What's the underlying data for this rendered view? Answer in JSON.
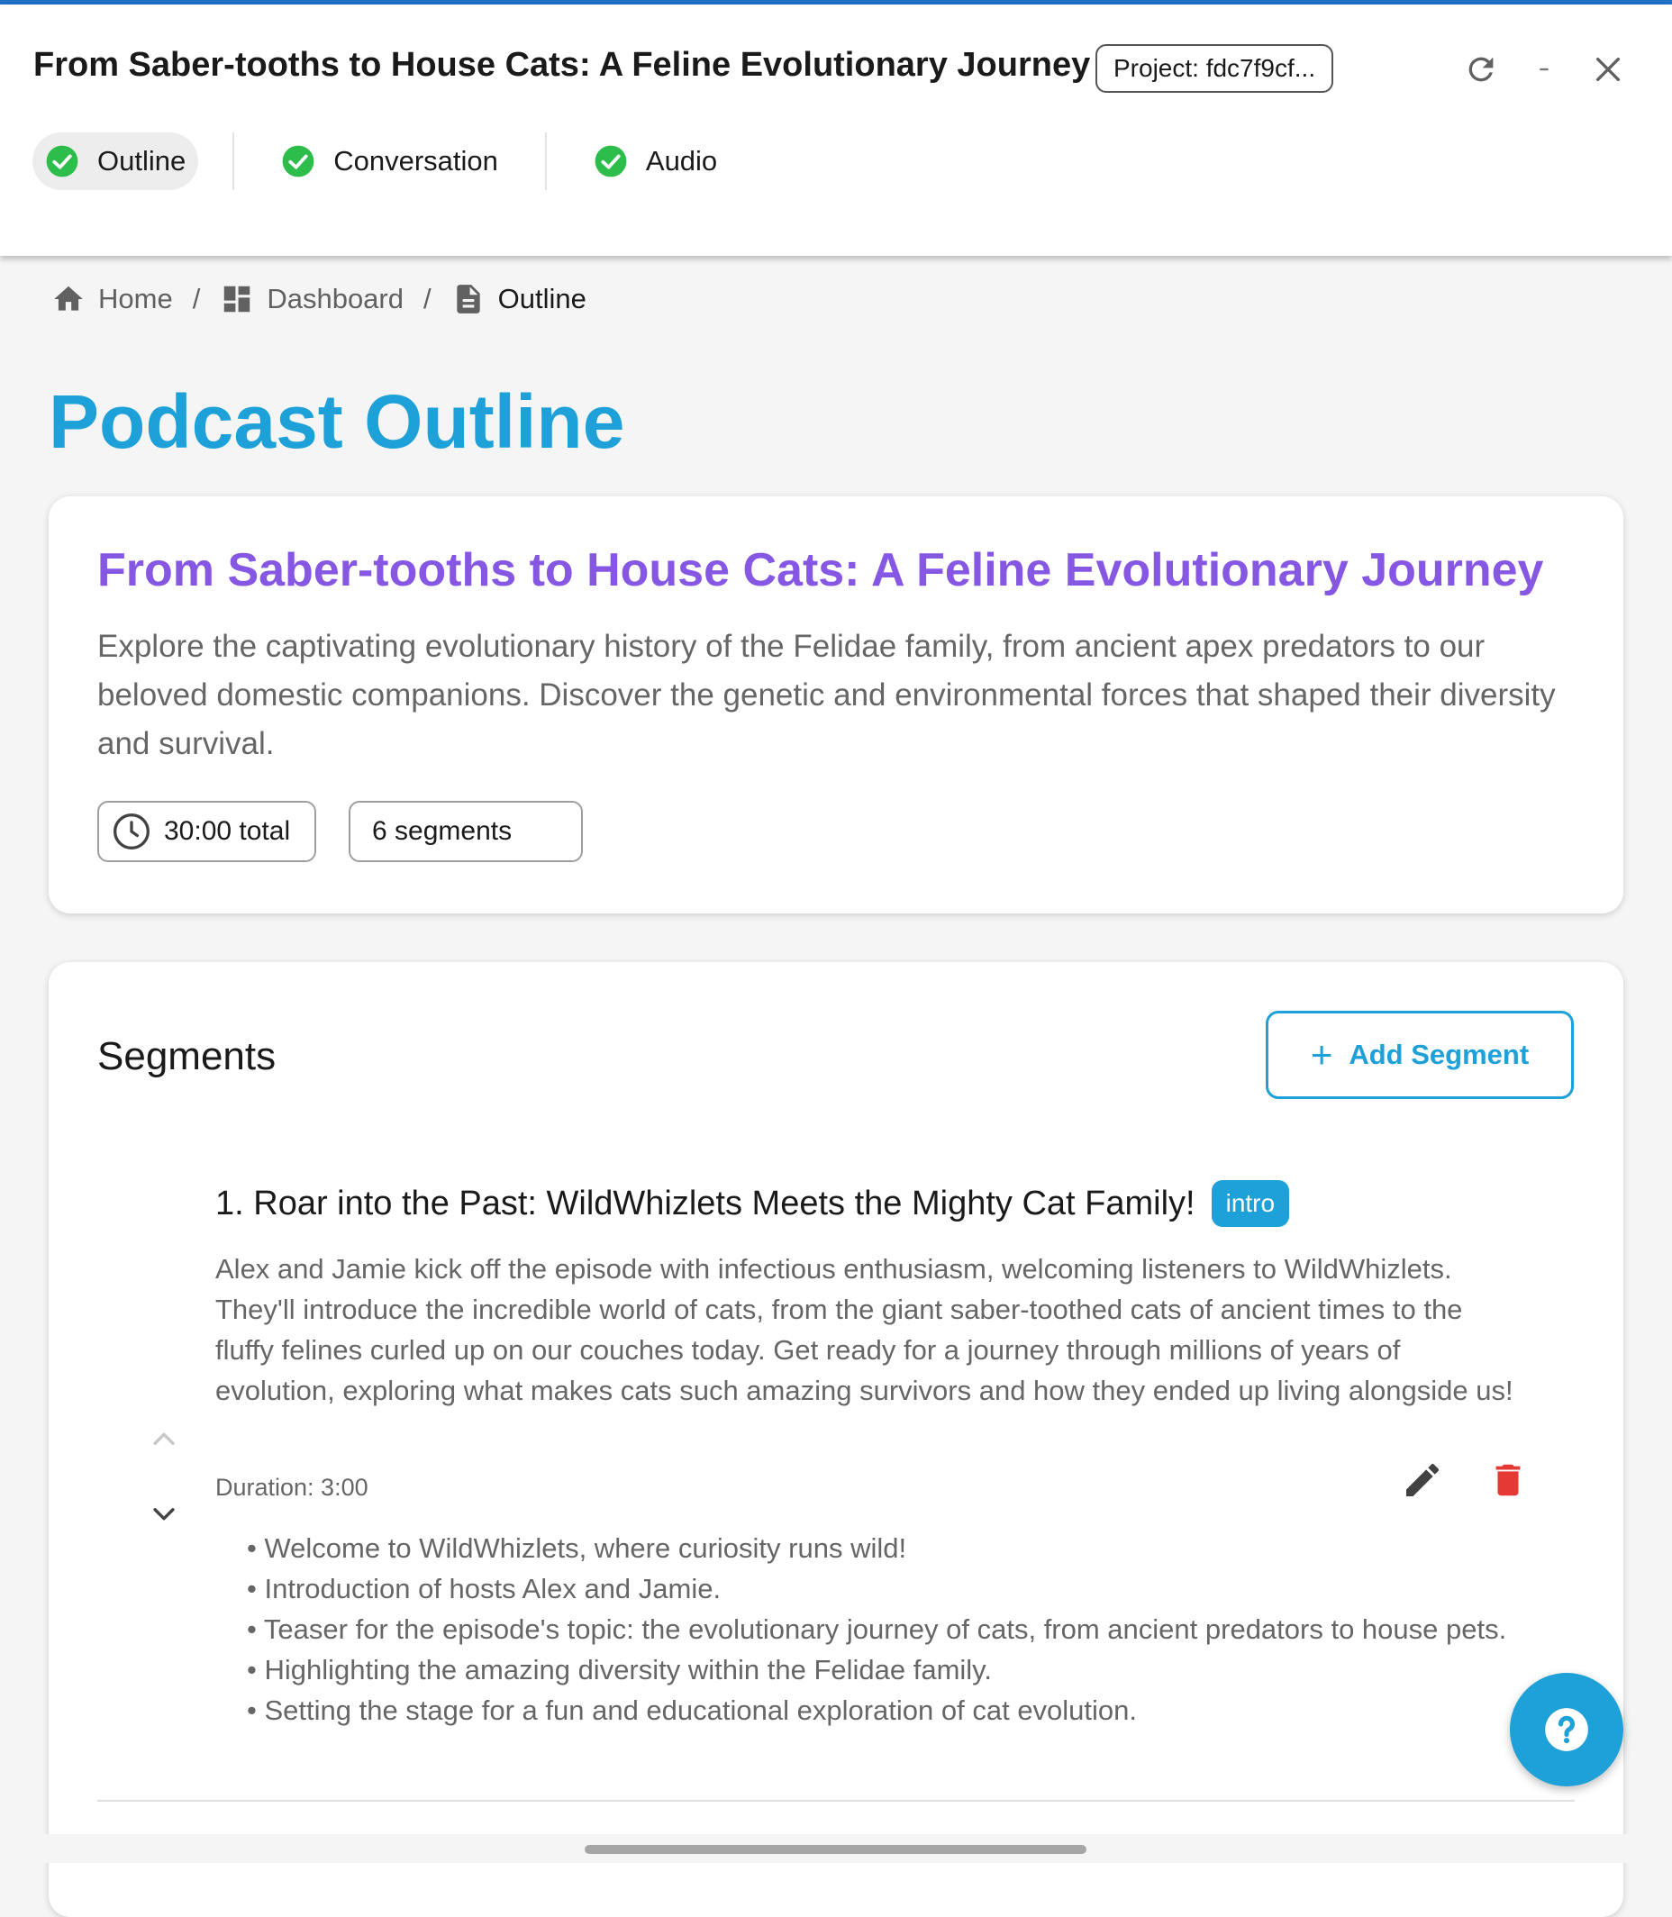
{
  "header": {
    "title": "From Saber-tooths to House Cats: A Feline Evolutionary Journey",
    "project_label": "Project: fdc7f9cf...",
    "steps": [
      {
        "label": "Outline",
        "active": true
      },
      {
        "label": "Conversation",
        "active": false
      },
      {
        "label": "Audio",
        "active": false
      }
    ]
  },
  "breadcrumb": {
    "home": "Home",
    "dashboard": "Dashboard",
    "current": "Outline",
    "separator": "/"
  },
  "page": {
    "title": "Podcast Outline"
  },
  "summary": {
    "title": "From Saber-tooths to House Cats: A Feline Evolutionary Journey",
    "description": "Explore the captivating evolutionary history of the Felidae family, from ancient apex predators to our beloved domestic companions. Discover the genetic and environmental forces that shaped their diversity and survival.",
    "duration": "30:00 total",
    "segments_count": "6 segments"
  },
  "segments": {
    "title": "Segments",
    "add_label": "Add Segment",
    "items": [
      {
        "title": "1. Roar into the Past: WildWhizlets Meets the Mighty Cat Family!",
        "tag": "intro",
        "description": "Alex and Jamie kick off the episode with infectious enthusiasm, welcoming listeners to WildWhizlets. They'll introduce the incredible world of cats, from the giant saber-toothed cats of ancient times to the fluffy felines curled up on our couches today. Get ready for a journey through millions of years of evolution, exploring what makes cats such amazing survivors and how they ended up living alongside us!",
        "duration": "Duration: 3:00",
        "points": [
          "Welcome to WildWhizlets, where curiosity runs wild!",
          "Introduction of hosts Alex and Jamie.",
          "Teaser for the episode's topic: the evolutionary journey of cats, from ancient predators to house pets.",
          "Highlighting the amazing diversity within the Felidae family.",
          "Setting the stage for a fun and educational exploration of cat evolution."
        ]
      }
    ]
  },
  "colors": {
    "accent_blue": "#1ea0d8",
    "title_purple": "#8557e3",
    "success_green": "#2dbd4a",
    "delete_red": "#e53935"
  },
  "icons": {
    "refresh": "refresh-icon",
    "minimize": "minimize-icon",
    "close": "close-icon",
    "home": "home-icon",
    "dashboard": "dashboard-icon",
    "document": "document-icon",
    "clock": "clock-icon",
    "edit": "pencil-icon",
    "delete": "trash-icon",
    "help": "help-icon"
  }
}
